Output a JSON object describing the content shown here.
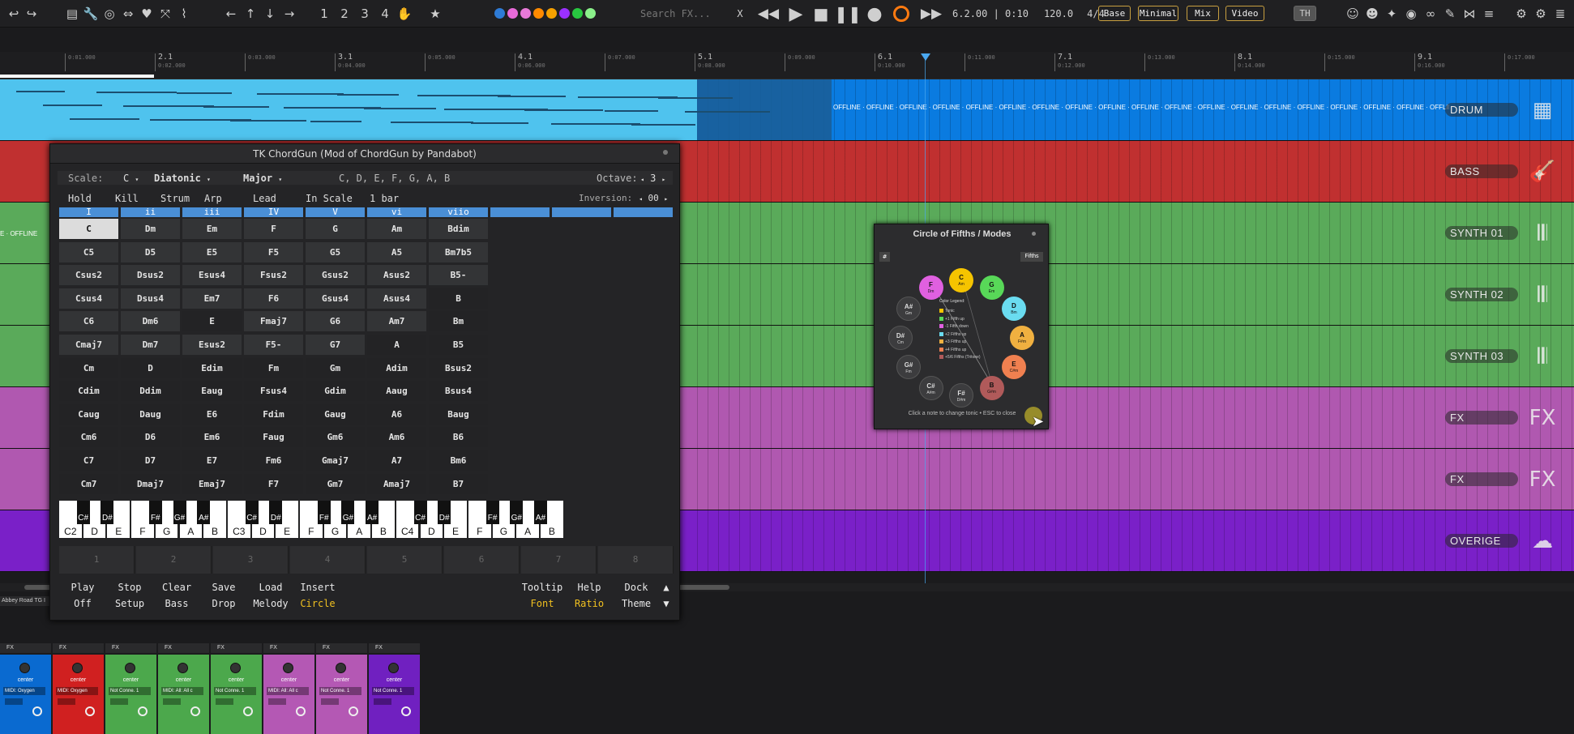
{
  "toolbar": {
    "search_placeholder": "Search FX...",
    "clear_x": "X",
    "numbers": [
      "1",
      "2",
      "3",
      "4"
    ],
    "position": "6.2.00 | 0:10",
    "tempo": "120.0",
    "timesig": "4/4",
    "views": [
      "Base",
      "Minimal",
      "Mix",
      "Video"
    ],
    "user_badge": "TH",
    "dot_colors": [
      "#2e7bd6",
      "#e86ad8",
      "#e87ad8",
      "#ff8a00",
      "#f5a000",
      "#9b30ff",
      "#28c840",
      "#8af08a"
    ]
  },
  "ruler": {
    "marks": [
      {
        "bar": "",
        "time": "0:01.000"
      },
      {
        "bar": "2.1",
        "time": "0:02.000"
      },
      {
        "bar": "",
        "time": "0:03.000"
      },
      {
        "bar": "3.1",
        "time": "0:04.000"
      },
      {
        "bar": "",
        "time": "0:05.000"
      },
      {
        "bar": "4.1",
        "time": "0:06.000"
      },
      {
        "bar": "",
        "time": "0:07.000"
      },
      {
        "bar": "5.1",
        "time": "0:08.000"
      },
      {
        "bar": "",
        "time": "0:09.000"
      },
      {
        "bar": "6.1",
        "time": "0:10.000"
      },
      {
        "bar": "",
        "time": "0:11.000"
      },
      {
        "bar": "7.1",
        "time": "0:12.000"
      },
      {
        "bar": "",
        "time": "0:13.000"
      },
      {
        "bar": "8.1",
        "time": "0:14.000"
      },
      {
        "bar": "",
        "time": "0:15.000"
      },
      {
        "bar": "9.1",
        "time": "0:16.000"
      },
      {
        "bar": "",
        "time": "0:17.000"
      }
    ]
  },
  "tracks": [
    {
      "name": "DRUM",
      "color": "#0a7be0",
      "offline": "OFFLINE · OFFLINE · OFFLINE · OFFLINE · OFFLINE · OFFLINE · OFFLINE · OFFLINE · OFFLINE · OFFLINE · OFFLINE · OFFLINE · OFFLINE · OFFLINE · OFFLINE · OFFLINE · OFFLINE · OFFLINE · OFFLINE",
      "icon": "▦"
    },
    {
      "name": "BASS",
      "color": "#c03030",
      "offline": "",
      "icon": "🎸"
    },
    {
      "name": "SYNTH 01",
      "color": "#5aaa5a",
      "offline": "E · OFFLINE",
      "icon": "𝄃𝄃"
    },
    {
      "name": "SYNTH 02",
      "color": "#5aaa5a",
      "offline": "",
      "icon": "𝄃𝄃"
    },
    {
      "name": "SYNTH 03",
      "color": "#5aaa5a",
      "offline": "",
      "icon": "𝄃𝄃"
    },
    {
      "name": "FX",
      "color": "#b058b0",
      "offline": "",
      "icon": "FX"
    },
    {
      "name": "FX",
      "color": "#b058b0",
      "offline": "",
      "icon": "FX"
    },
    {
      "name": "OVERIGE",
      "color": "#7a20c8",
      "offline": "",
      "icon": "☁"
    }
  ],
  "chordgun": {
    "title": "TK ChordGun (Mod of ChordGun by Pandabot)",
    "scale_label": "Scale:",
    "tonic": "C",
    "type": "Diatonic",
    "mode": "Major",
    "notes": "C, D, E, F, G, A, B",
    "octave_label": "Octave:",
    "octave": "3",
    "controls": [
      "Hold",
      "Kill",
      "Strum",
      "Arp",
      "Lead",
      "In Scale",
      "1 bar"
    ],
    "inversion_label": "Inversion:",
    "inversion": "00",
    "degrees": [
      "I",
      "ii",
      "iii",
      "IV",
      "V",
      "vi",
      "viio",
      "",
      "",
      ""
    ],
    "chords": [
      [
        "C",
        "Dm",
        "Em",
        "F",
        "G",
        "Am",
        "Bdim"
      ],
      [
        "C5",
        "D5",
        "E5",
        "F5",
        "G5",
        "A5",
        "Bm7b5"
      ],
      [
        "Csus2",
        "Dsus2",
        "Esus4",
        "Fsus2",
        "Gsus2",
        "Asus2",
        "B5-"
      ],
      [
        "Csus4",
        "Dsus4",
        "Em7",
        "F6",
        "Gsus4",
        "Asus4",
        "B"
      ],
      [
        "C6",
        "Dm6",
        "E",
        "Fmaj7",
        "G6",
        "Am7",
        "Bm"
      ],
      [
        "Cmaj7",
        "Dm7",
        "Esus2",
        "F5-",
        "G7",
        "A",
        "B5"
      ],
      [
        "Cm",
        "D",
        "Edim",
        "Fm",
        "Gm",
        "Adim",
        "Bsus2"
      ],
      [
        "Cdim",
        "Ddim",
        "Eaug",
        "Fsus4",
        "Gdim",
        "Aaug",
        "Bsus4"
      ],
      [
        "Caug",
        "Daug",
        "E6",
        "Fdim",
        "Gaug",
        "A6",
        "Baug"
      ],
      [
        "Cm6",
        "D6",
        "Em6",
        "Faug",
        "Gm6",
        "Am6",
        "B6"
      ],
      [
        "C7",
        "D7",
        "E7",
        "Fm6",
        "Gmaj7",
        "A7",
        "Bm6"
      ],
      [
        "Cm7",
        "Dmaj7",
        "Emaj7",
        "F7",
        "Gm7",
        "Amaj7",
        "B7"
      ]
    ],
    "white_keys": [
      "C2",
      "D",
      "E",
      "F",
      "G",
      "A",
      "B",
      "C3",
      "D",
      "E",
      "F",
      "G",
      "A",
      "B",
      "C4",
      "D",
      "E",
      "F",
      "G",
      "A",
      "B"
    ],
    "black_keys": [
      "C#",
      "D#",
      "F#",
      "G#",
      "A#",
      "C#",
      "D#",
      "F#",
      "G#",
      "A#",
      "C#",
      "D#",
      "F#",
      "G#",
      "A#"
    ],
    "steps": [
      "1",
      "2",
      "3",
      "4",
      "5",
      "6",
      "7",
      "8"
    ],
    "buttons_top": [
      "Play",
      "Stop",
      "Clear",
      "Save",
      "Load",
      "Insert"
    ],
    "buttons_bottom": [
      "Off",
      "Setup",
      "Bass",
      "Drop",
      "Melody",
      "Circle"
    ],
    "buttons_right_top": [
      "Tooltip",
      "Help",
      "Dock"
    ],
    "buttons_right_bottom": [
      "Font",
      "Ratio",
      "Theme"
    ],
    "arrow_up": "▲",
    "arrow_down": "▼"
  },
  "circle": {
    "title": "Circle of Fifths / Modes",
    "flat_btn": "#",
    "fifths_btn": "Fifths",
    "notes": [
      {
        "n": "C",
        "m": "Am",
        "c": "#f5c400"
      },
      {
        "n": "G",
        "m": "Em",
        "c": "#58d858"
      },
      {
        "n": "D",
        "m": "Bm",
        "c": "#6adcf0"
      },
      {
        "n": "A",
        "m": "F#m",
        "c": "#f0b040"
      },
      {
        "n": "E",
        "m": "C#m",
        "c": "#f08050"
      },
      {
        "n": "B",
        "m": "G#m",
        "c": "#b05a5a"
      },
      {
        "n": "F#",
        "m": "D#m",
        "c": "#3c3c3e"
      },
      {
        "n": "C#",
        "m": "A#m",
        "c": "#3c3c3e"
      },
      {
        "n": "G#",
        "m": "Fm",
        "c": "#3c3c3e"
      },
      {
        "n": "D#",
        "m": "Cm",
        "c": "#3c3c3e"
      },
      {
        "n": "A#",
        "m": "Gm",
        "c": "#3c3c3e"
      },
      {
        "n": "F",
        "m": "Dm",
        "c": "#e060e0"
      }
    ],
    "legend_title": "Color Legend:",
    "legend": [
      {
        "t": "Tonic",
        "c": "#f5c400"
      },
      {
        "t": "+1 Fifth up",
        "c": "#58d858"
      },
      {
        "t": "-1 Fifth down",
        "c": "#e060e0"
      },
      {
        "t": "+2 Fifths up",
        "c": "#6adcf0"
      },
      {
        "t": "+3 Fifths up",
        "c": "#f0b040"
      },
      {
        "t": "+4 Fifths up",
        "c": "#f08050"
      },
      {
        "t": "+5/6 Fifths (Tritone)",
        "c": "#b05a5a"
      }
    ],
    "hint": "Click a note to change tonic • ESC to close"
  },
  "mixer": {
    "track_name_tag": "Abbey Road TG I",
    "strips": [
      {
        "color": "#0a6ad0",
        "input": "MIDI: Oxygen"
      },
      {
        "color": "#d02020",
        "input": "MIDI: Oxygen"
      },
      {
        "color": "#4ca84c",
        "input": "Not Conne. 1"
      },
      {
        "color": "#4ca84c",
        "input": "MIDI: All: All c"
      },
      {
        "color": "#4ca84c",
        "input": "Not Conne. 1"
      },
      {
        "color": "#b458b4",
        "input": "MIDI: All: All c"
      },
      {
        "color": "#b458b4",
        "input": "Not Conne. 1"
      },
      {
        "color": "#7020c0",
        "input": "Not Conne. 1"
      }
    ],
    "fx_label": "FX",
    "center_label": "center"
  }
}
